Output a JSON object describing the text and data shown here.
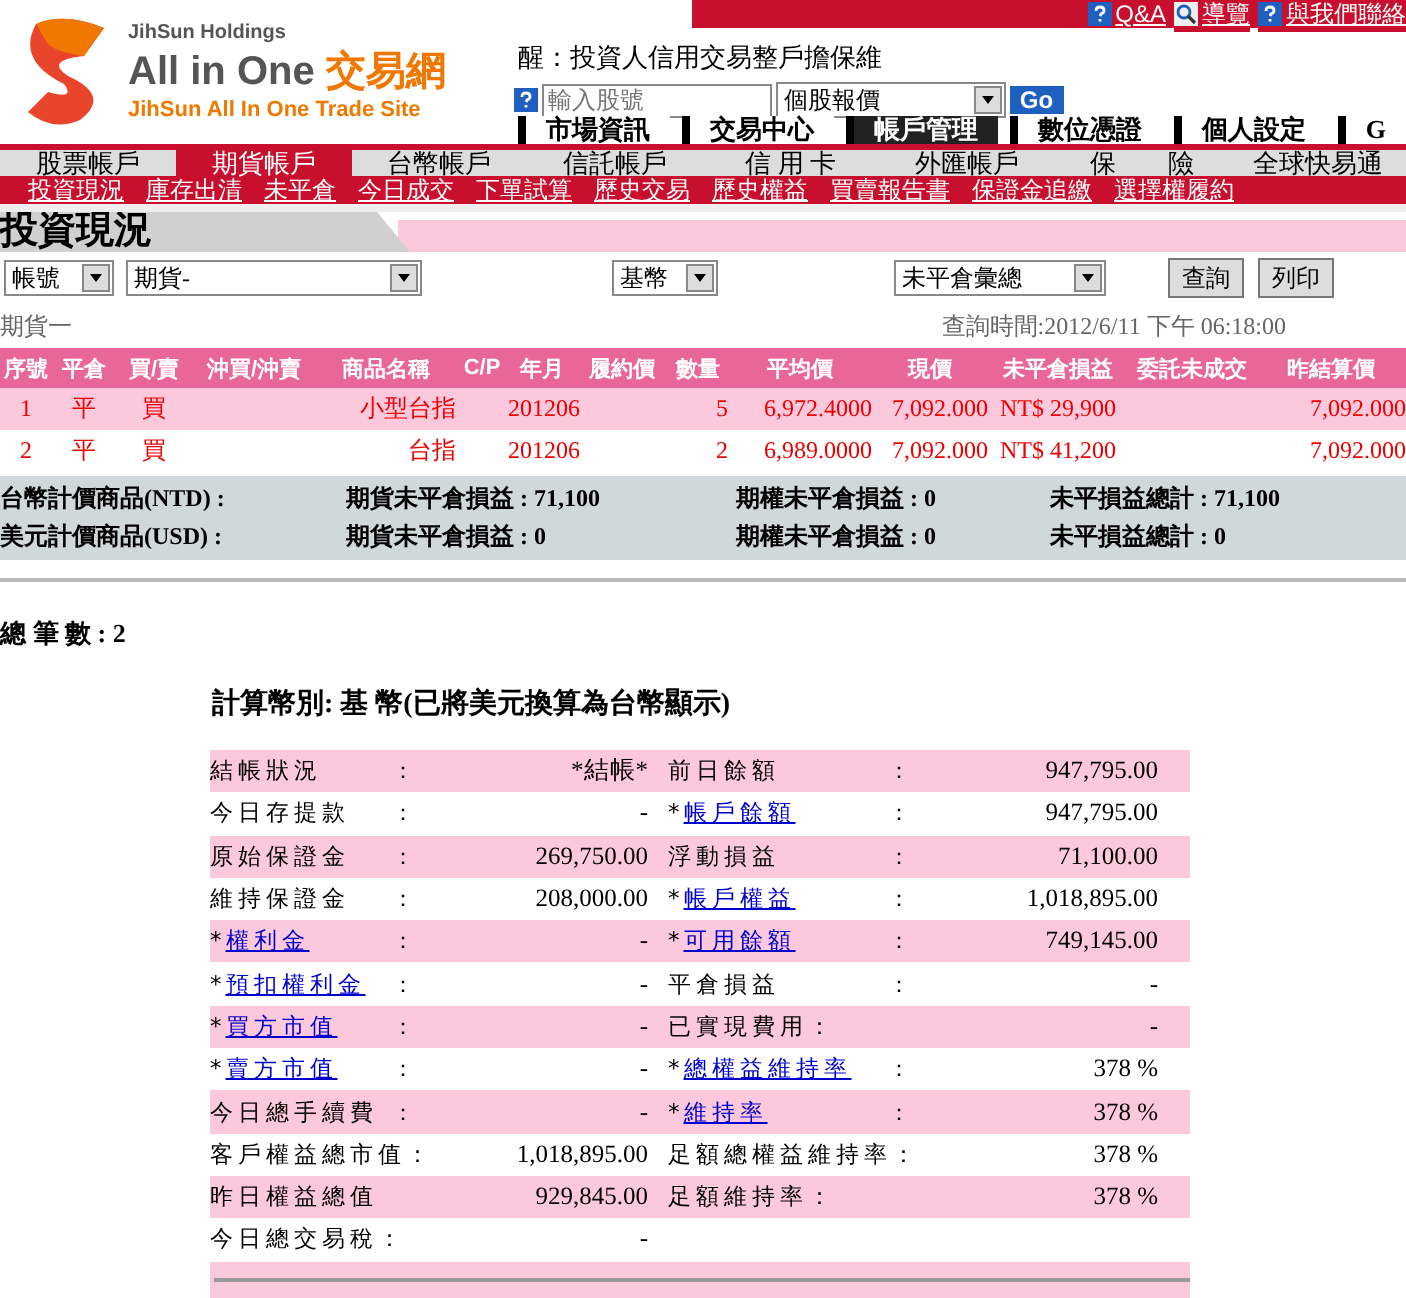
{
  "brand": {
    "holdings": "JihSun Holdings",
    "name": "All in One",
    "name_cjk": "交易網",
    "subtitle": "JihSun All In One Trade Site"
  },
  "top_links": [
    {
      "label": "Q&A",
      "kind": "help"
    },
    {
      "label": "導覽",
      "kind": "search"
    },
    {
      "label": "與我們聯絡",
      "kind": "help"
    }
  ],
  "ticker": "醒：投資人信用交易整戶擔保維",
  "quote": {
    "placeholder": "輸入股號",
    "select": "個股報價",
    "go": "Go"
  },
  "main_tabs": [
    {
      "label": "市場資訊",
      "selected": false
    },
    {
      "label": "交易中心",
      "selected": false
    },
    {
      "label": "帳戶管理",
      "selected": true
    },
    {
      "label": "數位憑證",
      "selected": false
    },
    {
      "label": "個人設定",
      "selected": false
    },
    {
      "label": "G",
      "selected": false
    }
  ],
  "account_tabs": [
    {
      "label": "股票帳戶",
      "selected": false
    },
    {
      "label": "期貨帳戶",
      "selected": true
    },
    {
      "label": "台幣帳戶",
      "selected": false
    },
    {
      "label": "信託帳戶",
      "selected": false
    },
    {
      "label": "信 用 卡",
      "selected": false
    },
    {
      "label": "外匯帳戶",
      "selected": false
    },
    {
      "label": "保　　險",
      "selected": false
    },
    {
      "label": "全球快易通",
      "selected": false
    }
  ],
  "sub_links": [
    "投資現況",
    "庫存出清",
    "未平倉",
    "今日成交",
    "下單試算",
    "歷史交易",
    "歷史權益",
    "買賣報告書",
    "保證金追繳",
    "選擇權履約"
  ],
  "page_title": "投資現況",
  "filters": {
    "account_type": "帳號",
    "account": "期貨-",
    "currency": "基幣",
    "view": "未平倉彙總",
    "query": "查詢",
    "print": "列印"
  },
  "account_label": "期貨一",
  "query_time": "查詢時間:2012/6/11 下午 06:18:00",
  "table": {
    "columns": [
      "序號",
      "平倉",
      "買/賣",
      "沖買/沖賣",
      "商品名稱",
      "C/P",
      "年月",
      "履約價",
      "數量",
      "平均價",
      "現價",
      "未平倉損益",
      "委託未成交",
      "昨結算價"
    ],
    "rows": [
      [
        "1",
        "平",
        "買",
        "",
        "小型台指",
        "",
        "201206",
        "",
        "5",
        "6,972.4000",
        "7,092.000",
        "NT$ 29,900",
        "",
        "7,092.000"
      ],
      [
        "2",
        "平",
        "買",
        "",
        "台指",
        "",
        "201206",
        "",
        "2",
        "6,989.0000",
        "7,092.000",
        "NT$ 41,200",
        "",
        "7,092.000"
      ]
    ]
  },
  "summary": [
    [
      "台幣計價商品(NTD) :",
      "期貨未平倉損益 : 71,100",
      "期權未平倉損益 : 0",
      "未平損益總計 : 71,100"
    ],
    [
      "美元計價商品(USD) :",
      "期貨未平倉損益 : 0",
      "期權未平倉損益 : 0",
      "未平損益總計 : 0"
    ]
  ],
  "total_count": "總 筆 數 : 2",
  "calc_title": "計算幣別: 基 幣(已將美元換算為台幣顯示)",
  "details": [
    {
      "left": {
        "label": "結帳狀況",
        "colon": "：",
        "value": "*結帳*"
      },
      "right": {
        "label": "前日餘額",
        "colon": "：",
        "value": "947,795.00"
      }
    },
    {
      "left": {
        "label": "今日存提款",
        "colon": "：",
        "value": "-"
      },
      "right": {
        "star": "*",
        "label": "帳戶餘額",
        "link": true,
        "colon": "：",
        "value": "947,795.00"
      }
    },
    {
      "left": {
        "label": "原始保證金",
        "colon": "：",
        "value": "269,750.00"
      },
      "right": {
        "label": "浮動損益",
        "colon": "：",
        "value": "71,100.00"
      }
    },
    {
      "left": {
        "label": "維持保證金",
        "colon": "：",
        "value": "208,000.00"
      },
      "right": {
        "star": "*",
        "label": "帳戶權益",
        "link": true,
        "colon": "：",
        "value": "1,018,895.00"
      }
    },
    {
      "left": {
        "star": "*",
        "label": "權利金",
        "link": true,
        "colon": "：",
        "value": "-"
      },
      "right": {
        "star": "*",
        "label": "可用餘額",
        "link": true,
        "colon": "：",
        "value": "749,145.00"
      }
    },
    {
      "left": {
        "star": "*",
        "label": "預扣權利金",
        "link": true,
        "colon": "：",
        "value": "-"
      },
      "right": {
        "label": "平倉損益",
        "colon": "：",
        "value": "-"
      }
    },
    {
      "left": {
        "star": "*",
        "label": "買方市值",
        "link": true,
        "colon": "：",
        "value": "-"
      },
      "right": {
        "label": "已實現費用：",
        "value": "-"
      }
    },
    {
      "left": {
        "star": "*",
        "label": "賣方市值",
        "link": true,
        "colon": "：",
        "value": "-"
      },
      "right": {
        "star": "*",
        "label": "總權益維持率",
        "link": true,
        "colon": "：",
        "value": "378 %"
      }
    },
    {
      "left": {
        "label": "今日總手續費",
        "colon": "：",
        "value": "-"
      },
      "right": {
        "star": "*",
        "label": "維持率",
        "link": true,
        "colon": "：",
        "value": "378 %"
      }
    },
    {
      "left": {
        "label": "客戶權益總市值：",
        "value": "1,018,895.00"
      },
      "right": {
        "label": "足額總權益維持率：",
        "value": "378 %"
      }
    },
    {
      "left": {
        "label": "昨日權益總值",
        "value": "929,845.00"
      },
      "right": {
        "label": "足額維持率：",
        "value": "378 %"
      }
    },
    {
      "left": {
        "label": "今日總交易稅：",
        "value": "-"
      }
    }
  ]
}
